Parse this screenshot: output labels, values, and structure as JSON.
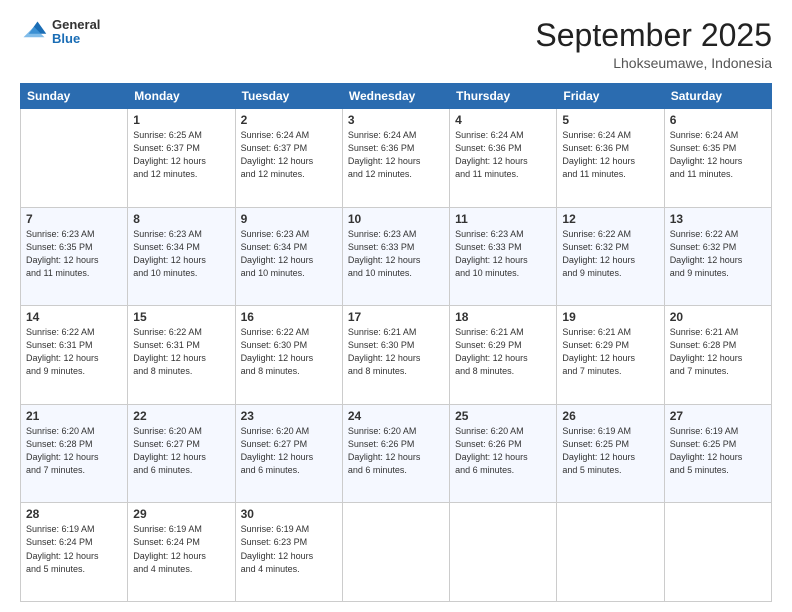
{
  "header": {
    "logo": {
      "general": "General",
      "blue": "Blue"
    },
    "title": "September 2025",
    "subtitle": "Lhokseumawe, Indonesia"
  },
  "days_of_week": [
    "Sunday",
    "Monday",
    "Tuesday",
    "Wednesday",
    "Thursday",
    "Friday",
    "Saturday"
  ],
  "weeks": [
    [
      {
        "day": "",
        "info": ""
      },
      {
        "day": "1",
        "info": "Sunrise: 6:25 AM\nSunset: 6:37 PM\nDaylight: 12 hours\nand 12 minutes."
      },
      {
        "day": "2",
        "info": "Sunrise: 6:24 AM\nSunset: 6:37 PM\nDaylight: 12 hours\nand 12 minutes."
      },
      {
        "day": "3",
        "info": "Sunrise: 6:24 AM\nSunset: 6:36 PM\nDaylight: 12 hours\nand 12 minutes."
      },
      {
        "day": "4",
        "info": "Sunrise: 6:24 AM\nSunset: 6:36 PM\nDaylight: 12 hours\nand 11 minutes."
      },
      {
        "day": "5",
        "info": "Sunrise: 6:24 AM\nSunset: 6:36 PM\nDaylight: 12 hours\nand 11 minutes."
      },
      {
        "day": "6",
        "info": "Sunrise: 6:24 AM\nSunset: 6:35 PM\nDaylight: 12 hours\nand 11 minutes."
      }
    ],
    [
      {
        "day": "7",
        "info": "Sunrise: 6:23 AM\nSunset: 6:35 PM\nDaylight: 12 hours\nand 11 minutes."
      },
      {
        "day": "8",
        "info": "Sunrise: 6:23 AM\nSunset: 6:34 PM\nDaylight: 12 hours\nand 10 minutes."
      },
      {
        "day": "9",
        "info": "Sunrise: 6:23 AM\nSunset: 6:34 PM\nDaylight: 12 hours\nand 10 minutes."
      },
      {
        "day": "10",
        "info": "Sunrise: 6:23 AM\nSunset: 6:33 PM\nDaylight: 12 hours\nand 10 minutes."
      },
      {
        "day": "11",
        "info": "Sunrise: 6:23 AM\nSunset: 6:33 PM\nDaylight: 12 hours\nand 10 minutes."
      },
      {
        "day": "12",
        "info": "Sunrise: 6:22 AM\nSunset: 6:32 PM\nDaylight: 12 hours\nand 9 minutes."
      },
      {
        "day": "13",
        "info": "Sunrise: 6:22 AM\nSunset: 6:32 PM\nDaylight: 12 hours\nand 9 minutes."
      }
    ],
    [
      {
        "day": "14",
        "info": "Sunrise: 6:22 AM\nSunset: 6:31 PM\nDaylight: 12 hours\nand 9 minutes."
      },
      {
        "day": "15",
        "info": "Sunrise: 6:22 AM\nSunset: 6:31 PM\nDaylight: 12 hours\nand 8 minutes."
      },
      {
        "day": "16",
        "info": "Sunrise: 6:22 AM\nSunset: 6:30 PM\nDaylight: 12 hours\nand 8 minutes."
      },
      {
        "day": "17",
        "info": "Sunrise: 6:21 AM\nSunset: 6:30 PM\nDaylight: 12 hours\nand 8 minutes."
      },
      {
        "day": "18",
        "info": "Sunrise: 6:21 AM\nSunset: 6:29 PM\nDaylight: 12 hours\nand 8 minutes."
      },
      {
        "day": "19",
        "info": "Sunrise: 6:21 AM\nSunset: 6:29 PM\nDaylight: 12 hours\nand 7 minutes."
      },
      {
        "day": "20",
        "info": "Sunrise: 6:21 AM\nSunset: 6:28 PM\nDaylight: 12 hours\nand 7 minutes."
      }
    ],
    [
      {
        "day": "21",
        "info": "Sunrise: 6:20 AM\nSunset: 6:28 PM\nDaylight: 12 hours\nand 7 minutes."
      },
      {
        "day": "22",
        "info": "Sunrise: 6:20 AM\nSunset: 6:27 PM\nDaylight: 12 hours\nand 6 minutes."
      },
      {
        "day": "23",
        "info": "Sunrise: 6:20 AM\nSunset: 6:27 PM\nDaylight: 12 hours\nand 6 minutes."
      },
      {
        "day": "24",
        "info": "Sunrise: 6:20 AM\nSunset: 6:26 PM\nDaylight: 12 hours\nand 6 minutes."
      },
      {
        "day": "25",
        "info": "Sunrise: 6:20 AM\nSunset: 6:26 PM\nDaylight: 12 hours\nand 6 minutes."
      },
      {
        "day": "26",
        "info": "Sunrise: 6:19 AM\nSunset: 6:25 PM\nDaylight: 12 hours\nand 5 minutes."
      },
      {
        "day": "27",
        "info": "Sunrise: 6:19 AM\nSunset: 6:25 PM\nDaylight: 12 hours\nand 5 minutes."
      }
    ],
    [
      {
        "day": "28",
        "info": "Sunrise: 6:19 AM\nSunset: 6:24 PM\nDaylight: 12 hours\nand 5 minutes."
      },
      {
        "day": "29",
        "info": "Sunrise: 6:19 AM\nSunset: 6:24 PM\nDaylight: 12 hours\nand 4 minutes."
      },
      {
        "day": "30",
        "info": "Sunrise: 6:19 AM\nSunset: 6:23 PM\nDaylight: 12 hours\nand 4 minutes."
      },
      {
        "day": "",
        "info": ""
      },
      {
        "day": "",
        "info": ""
      },
      {
        "day": "",
        "info": ""
      },
      {
        "day": "",
        "info": ""
      }
    ]
  ]
}
